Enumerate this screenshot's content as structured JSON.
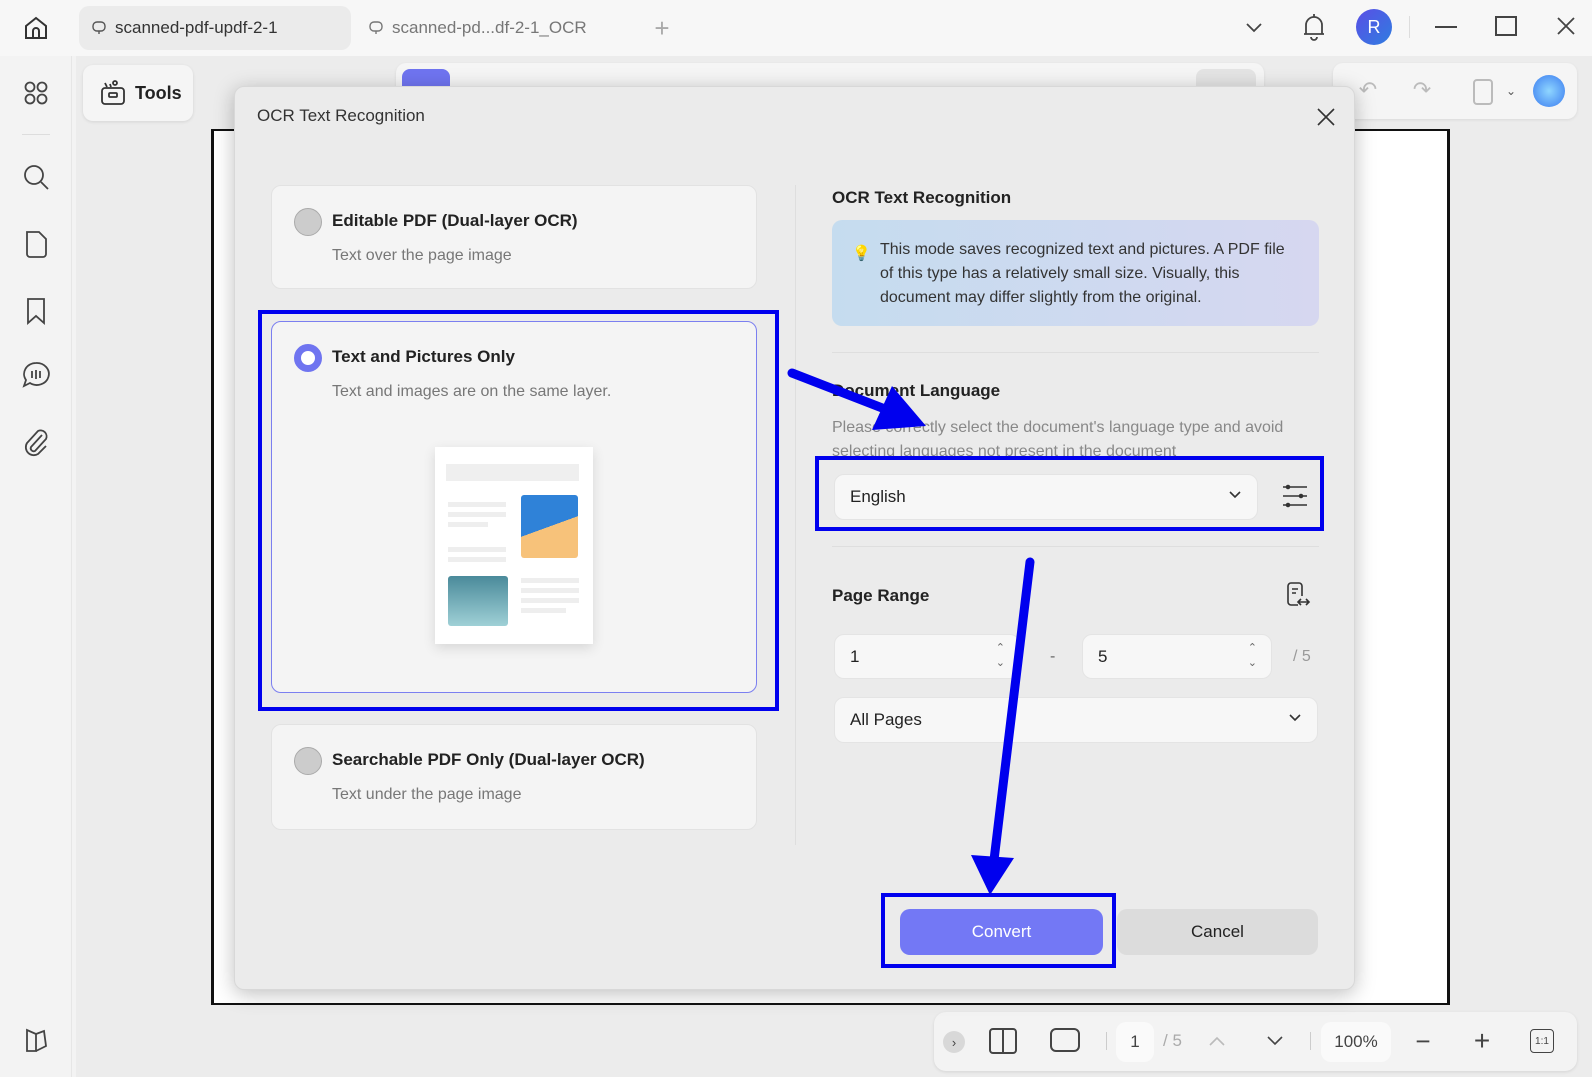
{
  "tabs": [
    {
      "label": "scanned-pdf-updf-2-1",
      "active": true
    },
    {
      "label": "scanned-pd...df-2-1_OCR",
      "active": false
    }
  ],
  "user": {
    "avatar_initial": "R",
    "avatar_color": "#4f5de8"
  },
  "toolbar": {
    "tools_label": "Tools"
  },
  "dialog": {
    "title": "OCR Text Recognition",
    "options": [
      {
        "title": "Editable PDF (Dual-layer OCR)",
        "subtitle": "Text over the page image",
        "selected": false
      },
      {
        "title": "Text and Pictures Only",
        "subtitle": "Text and images are on the same layer.",
        "selected": true
      },
      {
        "title": "Searchable PDF Only (Dual-layer OCR)",
        "subtitle": "Text under the page image",
        "selected": false
      }
    ],
    "right": {
      "heading": "OCR Text Recognition",
      "info": "This mode saves recognized text and pictures. A PDF file of this type has a relatively small size. Visually, this document may differ slightly from the original.",
      "language_heading": "Document Language",
      "language_desc": "Please correctly select the document's language type and avoid selecting languages not present in the document",
      "language_value": "English",
      "page_range_heading": "Page Range",
      "from_page": "1",
      "dash": "-",
      "to_page": "5",
      "total_pages": "/ 5",
      "range_option": "All Pages"
    },
    "convert_label": "Convert",
    "cancel_label": "Cancel"
  },
  "bottom": {
    "page": "1",
    "total": "/ 5",
    "zoom": "100%",
    "actual_size": "1:1"
  },
  "colors": {
    "accent": "#7378f5",
    "annotation": "#0000ee"
  }
}
